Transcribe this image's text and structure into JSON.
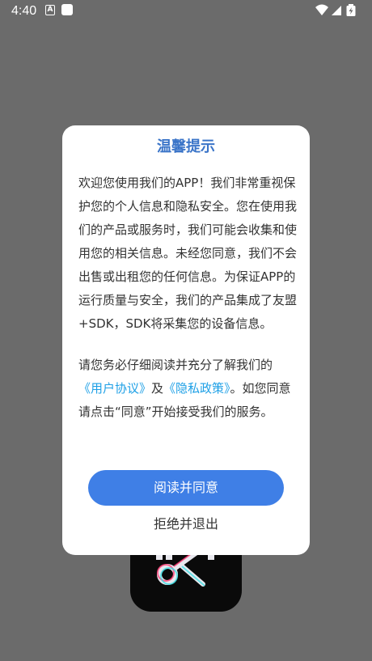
{
  "status_bar": {
    "time": "4:40",
    "notif_icon_letter": "A",
    "icons": [
      "a-notification-icon",
      "square-notification-icon",
      "wifi-icon",
      "cellular-signal-icon",
      "battery-icon"
    ]
  },
  "dialog": {
    "title": "温馨提示",
    "para1": "欢迎您使用我们的APP！我们非常重视保护您的个人信息和隐私安全。您在使用我们的产品或服务时，我们可能会收集和使用您的相关信息。未经您同意，我们不会出售或出租您的任何信息。为保证APP的运行质量与安全，我们的产品集成了友盟+SDK，SDK将采集您的设备信息。",
    "para2_prefix": "请您务必仔细阅读并充分了解我们的",
    "user_agreement_link": "《用户协议》",
    "and_text": "及",
    "privacy_policy_link": "《隐私政策》",
    "para2_suffix": "。如您同意请点击“同意”开始接受我们的服务。",
    "agree_button": "阅读并同意",
    "refuse_button": "拒绝并退出"
  },
  "colors": {
    "scrim": "#6b6b6b",
    "title": "#3a74c8",
    "link": "#1ea0e6",
    "primary_button": "#3f7fe6",
    "body_text": "#333333"
  }
}
